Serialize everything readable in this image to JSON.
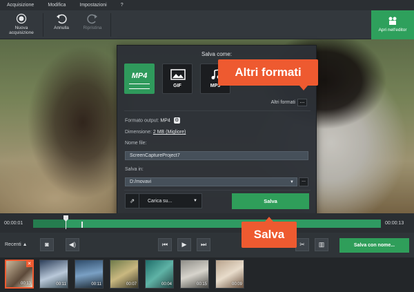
{
  "menu": [
    "Acquisizione",
    "Modifica",
    "Impostazioni",
    "?"
  ],
  "toolbar": {
    "new_capture": "Nuova acquisizione",
    "undo": "Annulla",
    "redo": "Ripristina",
    "open_editor": "Apri nell'editor"
  },
  "dialog": {
    "title": "Salva come:",
    "formats": [
      "MP4",
      "GIF",
      "MP3"
    ],
    "more_formats": "Altri formati",
    "more_button": "...",
    "output_format_label": "Formato output:",
    "output_format_value": "MP4",
    "size_label": "Dimensione:",
    "size_value": "2 MB (Migliore)",
    "filename_label": "Nome file:",
    "filename_value": "ScreenCaptureProject7",
    "save_in_label": "Salva in:",
    "save_in_value": "D:/movavi",
    "upload_label": "Carica su...",
    "save_button": "Salva"
  },
  "callouts": {
    "more_formats": "Altri formati",
    "save": "Salva"
  },
  "timeline": {
    "start_time": "00:00:01",
    "end_time": "00:00:13",
    "progress": 0.09
  },
  "controls": {
    "recent_label": "Recenti",
    "save_as_button": "Salva con nome..."
  },
  "thumbnails": [
    {
      "duration": "00:13",
      "active": true
    },
    {
      "duration": "00:11",
      "active": false
    },
    {
      "duration": "00:11",
      "active": false
    },
    {
      "duration": "00:07",
      "active": false
    },
    {
      "duration": "00:04",
      "active": false
    },
    {
      "duration": "00:15",
      "active": false
    },
    {
      "duration": "00:09",
      "active": false
    }
  ],
  "colors": {
    "accent_green": "#2f9e5a",
    "callout_orange": "#ee5a30"
  }
}
